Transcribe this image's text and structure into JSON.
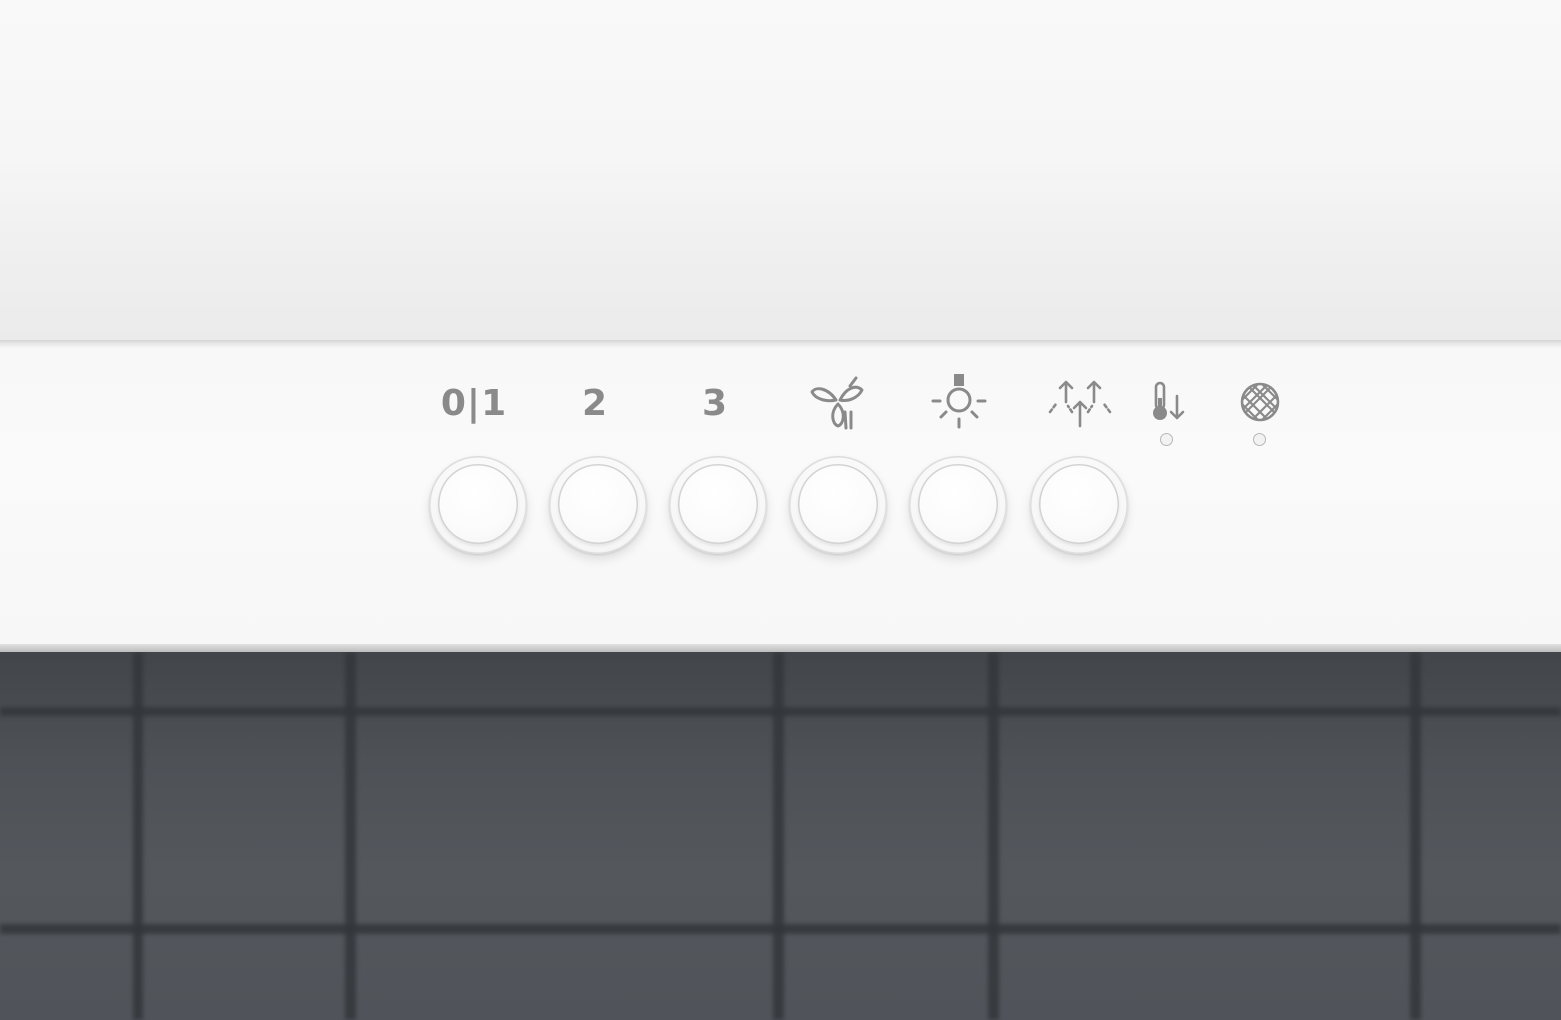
{
  "panel": {
    "buttons": [
      {
        "label": "0|1",
        "icon": "power-speed-1"
      },
      {
        "label": "2",
        "icon": "speed-2"
      },
      {
        "label": "3",
        "icon": "speed-3"
      },
      {
        "label": "",
        "icon": "fan-icon"
      },
      {
        "label": "",
        "icon": "light-icon"
      },
      {
        "label": "",
        "icon": "boost-icon"
      }
    ],
    "indicators": [
      {
        "icon": "temperature-down-icon",
        "led": "off"
      },
      {
        "icon": "grease-filter-icon",
        "led": "off"
      }
    ]
  },
  "colors": {
    "hood": "#f8f8f8",
    "symbol": "#8a8a8a",
    "tiles": "#4c5055",
    "grout": "#33363a"
  }
}
